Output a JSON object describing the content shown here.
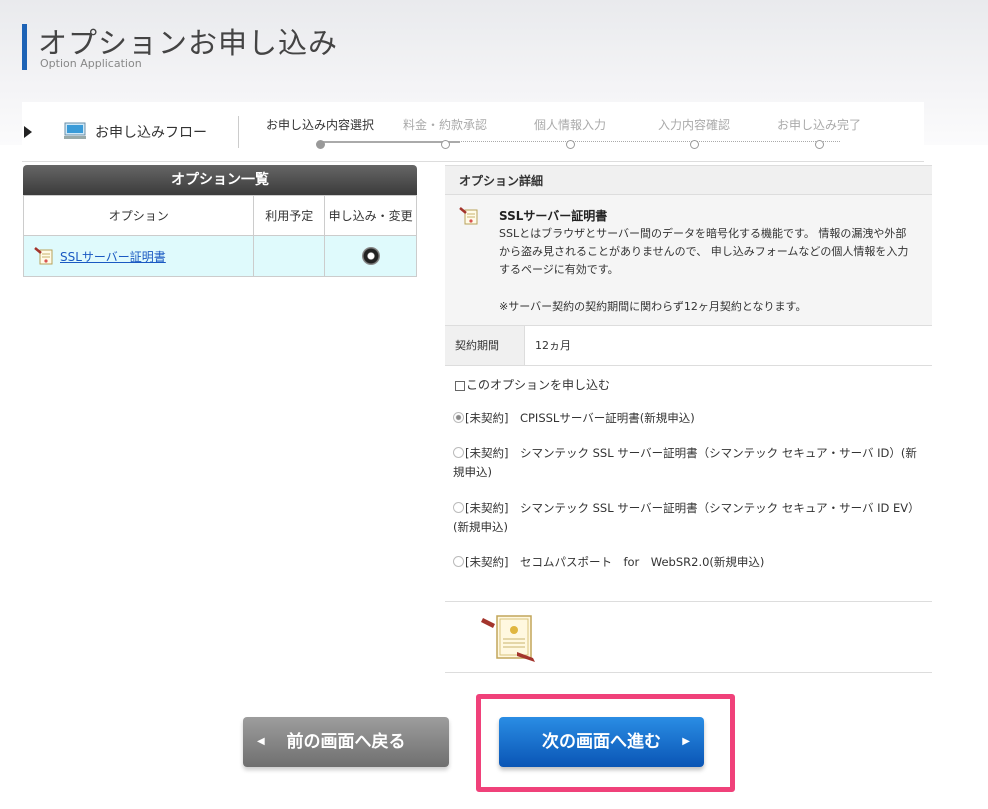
{
  "header": {
    "title": "オプションお申し込み",
    "subtitle": "Option Application"
  },
  "flow": {
    "label": "お申し込みフロー",
    "steps": [
      {
        "label": "お申し込み内容選択",
        "active": true
      },
      {
        "label": "料金・約款承認",
        "active": false
      },
      {
        "label": "個人情報入力",
        "active": false
      },
      {
        "label": "入力内容確認",
        "active": false
      },
      {
        "label": "お申し込み完了",
        "active": false
      }
    ]
  },
  "option_list": {
    "title": "オプション一覧",
    "columns": [
      "オプション",
      "利用予定",
      "申し込み・変更"
    ],
    "rows": [
      {
        "name": "SSLサーバー証明書",
        "usage": "",
        "selected": true
      }
    ]
  },
  "option_detail": {
    "title": "オプション詳細",
    "item_title": "SSLサーバー証明書",
    "description": "SSLとはブラウザとサーバー間のデータを暗号化する機能です。 情報の漏洩や外部から盗み見されることがありませんので、 申し込みフォームなどの個人情報を入力するページに有効です。",
    "note": "※サーバー契約の契約期間に関わらず12ヶ月契約となります。",
    "period_label": "契約期間",
    "period_value": "12ヵ月",
    "apply_checkbox_label": "このオプションを申し込む",
    "apply_checked": false,
    "plans": [
      {
        "label": "[未契約]　CPISSLサーバー証明書(新規申込)",
        "checked": true
      },
      {
        "label": "[未契約]　シマンテック SSL サーバー証明書（シマンテック セキュア・サーバ ID）(新規申込)",
        "checked": false
      },
      {
        "label": "[未契約]　シマンテック SSL サーバー証明書（シマンテック セキュア・サーバ ID EV）(新規申込)",
        "checked": false
      },
      {
        "label": "[未契約]　セコムパスポート　for　WebSR2.0(新規申込)",
        "checked": false
      }
    ]
  },
  "buttons": {
    "back": "前の画面へ戻る",
    "next": "次の画面へ進む"
  },
  "colors": {
    "accent": "#1d63b6",
    "next_button": "#0a55b5",
    "highlight": "#f0417a",
    "selected_row": "#dffafc"
  }
}
